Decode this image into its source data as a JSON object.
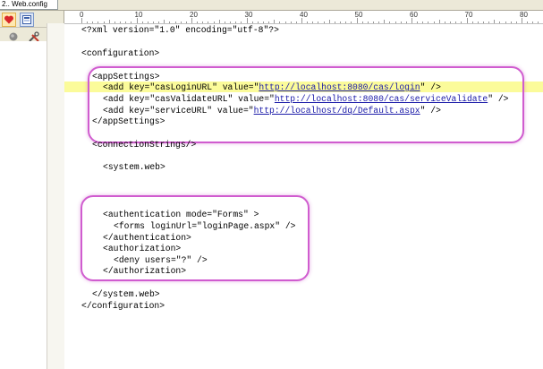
{
  "tab": {
    "title": "2.. Web.config"
  },
  "toolbar": {
    "icons": [
      "heart-icon",
      "address-book-icon",
      "record-icon",
      "tools-icon"
    ]
  },
  "ruler": {
    "labels": [
      "0",
      "10",
      "20",
      "30",
      "40",
      "50",
      "60",
      "70",
      "80"
    ]
  },
  "code": {
    "xml_decl": "<?xml version=\"1.0\" encoding=\"utf-8\"?>",
    "config_open": "<configuration>",
    "appsettings_open": "<appSettings>",
    "add1": {
      "pre": "<add key=\"casLoginURL\" value=\"",
      "url": "http://localhost:8080/cas/login",
      "post": "\" />"
    },
    "add2": {
      "pre": "<add key=\"casValidateURL\" value=\"",
      "url": "http://localhost:8080/cas/serviceValidate",
      "post": "\" />"
    },
    "add3": {
      "pre": "<add key=\"serviceURL\" value=\"",
      "url": "http://localhost/dq/Default.aspx",
      "post": "\" />"
    },
    "appsettings_close": "</appSettings>",
    "connstrings": "<connectionStrings/>",
    "sysweb_open": "<system.web>",
    "auth_open": "<authentication mode=\"Forms\" >",
    "forms": "<forms loginUrl=\"loginPage.aspx\" />",
    "auth_close": "</authentication>",
    "authz_open": "<authorization>",
    "deny": "<deny users=\"?\" />",
    "authz_close": "</authorization>",
    "sysweb_close": "</system.web>",
    "config_close": "</configuration>"
  },
  "colors": {
    "highlight": "#fbfb9a",
    "callout": "#d05ccf",
    "link": "#1a1aa8"
  }
}
